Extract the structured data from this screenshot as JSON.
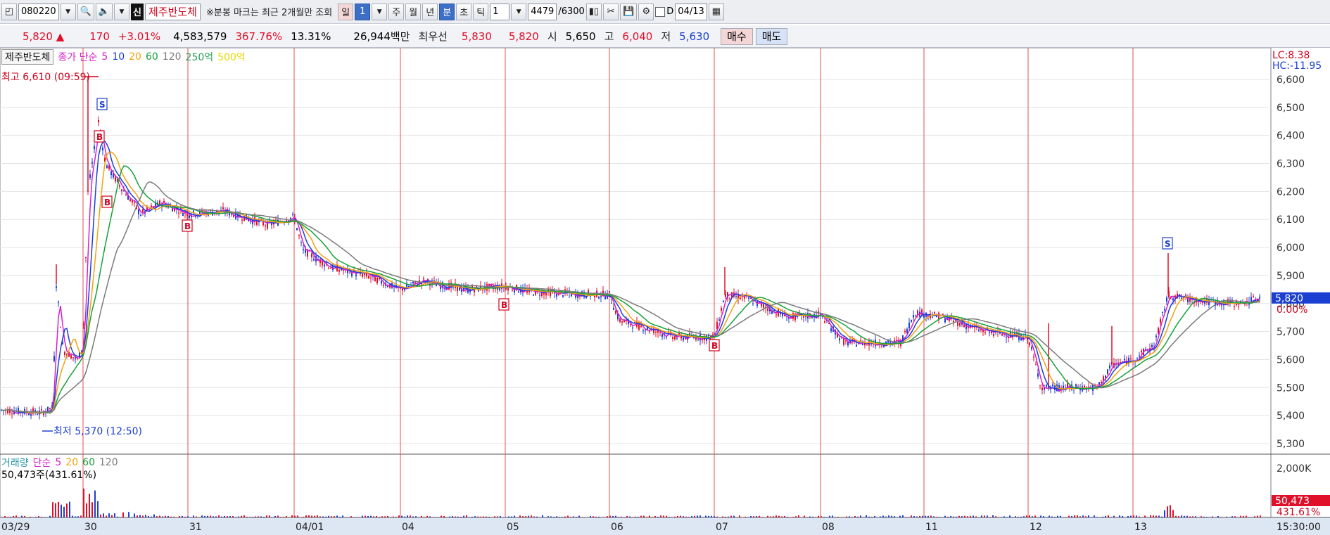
{
  "toolbar": {
    "code": "080220",
    "badge": "신",
    "stock_name": "제주반도체",
    "note": "※분봉 마크는 최근 2개월만 조회",
    "periods": [
      "일",
      "1",
      "주",
      "월",
      "년",
      "분",
      "초",
      "틱"
    ],
    "interval": "1",
    "count": "4479",
    "count_total": "/6300",
    "d_label": "D",
    "date": "04/13"
  },
  "quote": {
    "price": "5,820 ▲",
    "change": "170",
    "change_pct": "+3.01%",
    "volume": "4,583,579",
    "vol_ratio": "367.76%",
    "turnover": "13.31%",
    "amount": "26,944백만",
    "best_label": "최우선",
    "ask": "5,830",
    "bid": "5,820",
    "open_label": "시",
    "open": "5,650",
    "high_label": "고",
    "high": "6,040",
    "low_label": "저",
    "low": "5,630",
    "buy_label": "매수",
    "sell_label": "매도"
  },
  "price_panel": {
    "stock_box": "제주반도체",
    "legend_prefix": "종가 단순",
    "ma_labels": [
      "5",
      "10",
      "20",
      "60",
      "120",
      "250억",
      "500억"
    ],
    "ma_colors": [
      "#d61fcf",
      "#1a3fd8",
      "#f4a20b",
      "#16a23a",
      "#7b7b7b",
      "#2ba05a",
      "#f0e000"
    ],
    "lc": "LC:8.38",
    "hc": "HC:-11.95",
    "y_ticks": [
      "6,600",
      "6,500",
      "6,400",
      "6,300",
      "6,200",
      "6,100",
      "6,000",
      "5,900",
      "5,800",
      "5,700",
      "5,600",
      "5,500",
      "5,400",
      "5,300"
    ],
    "current_price": "5,820",
    "current_pct": "0.00%",
    "high_marker": "최고 6,610 (09:59)",
    "low_marker": "최저 5,370 (12:50)",
    "trade_marks": [
      "S",
      "B",
      "B",
      "B",
      "B",
      "B",
      "S"
    ]
  },
  "volume_panel": {
    "legend_prefix": "거래량",
    "legend_simple": "단순",
    "ma_labels": [
      "5",
      "20",
      "60",
      "120"
    ],
    "ma_colors": [
      "#d61fcf",
      "#f4a20b",
      "#16a23a",
      "#7b7b7b"
    ],
    "sub_label": "50,473주(431.61%)",
    "y_tick": "2,000K",
    "current_value": "50,473",
    "current_pct": "431.61%"
  },
  "x_axis": {
    "labels": [
      "03/29",
      "30",
      "31",
      "04/01",
      "04",
      "05",
      "06",
      "07",
      "08",
      "11",
      "12",
      "13"
    ],
    "end_time": "15:30:00"
  },
  "colors": {
    "up": "#e0102a",
    "down": "#1b3fd0",
    "divider": "#e05050",
    "current_bg": "#1b3fd0",
    "volume_current_bg": "#e0102a"
  }
}
